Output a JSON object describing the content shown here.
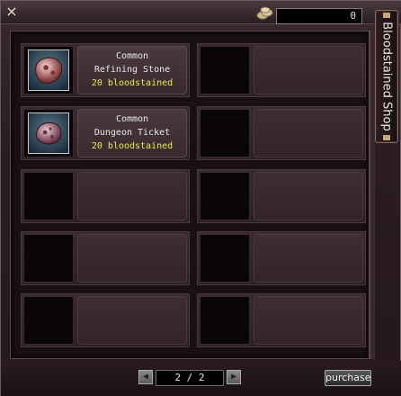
{
  "window": {
    "close_label": "×",
    "currency_value": "0",
    "shop_title": "Bloodstained Shop"
  },
  "items": [
    {
      "rarity": "Common",
      "name": "Refining Stone",
      "price": "20 bloodstained",
      "icon": "refining-stone-icon"
    },
    {
      "rarity": "Common",
      "name": "Dungeon Ticket",
      "price": "20 bloodstained",
      "icon": "dungeon-ticket-icon"
    }
  ],
  "pager": {
    "prev_label": "◀",
    "page": "2 / 2",
    "next_label": "▶"
  },
  "actions": {
    "purchase_label": "purchase"
  },
  "colors": {
    "price_text": "#e8e850",
    "panel_bg": "#1a1014",
    "frame": "#3a2a2e"
  }
}
